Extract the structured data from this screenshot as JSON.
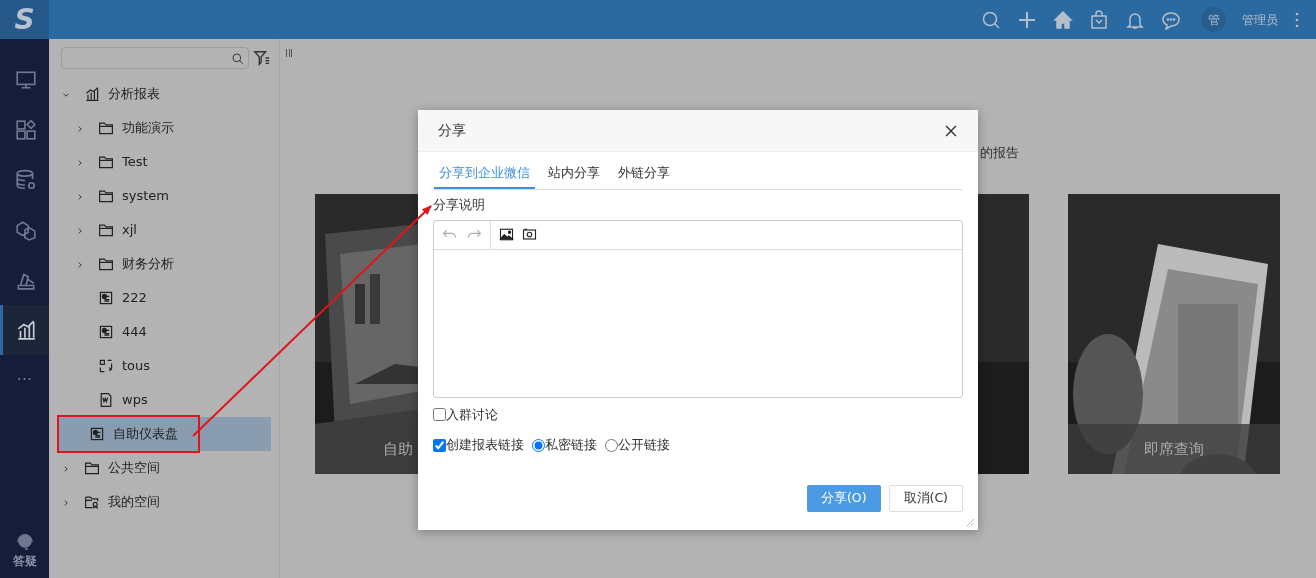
{
  "topbar": {
    "logo": "S",
    "avatar": "管",
    "user": "管理员"
  },
  "rail": {
    "items": [
      {
        "selected": false
      },
      {
        "selected": false
      },
      {
        "selected": false
      },
      {
        "selected": false
      },
      {
        "selected": false
      },
      {
        "selected": true
      }
    ],
    "more": "···",
    "help": "答疑"
  },
  "tree": {
    "nodes": [
      {
        "label": "分析报表",
        "kind": "chart",
        "expanded": true,
        "selected": false,
        "children": [
          {
            "label": "功能演示",
            "kind": "folder",
            "expanded": false,
            "selected": false
          },
          {
            "label": "Test",
            "kind": "folder",
            "expanded": false,
            "selected": false
          },
          {
            "label": "system",
            "kind": "folder",
            "expanded": false,
            "selected": false
          },
          {
            "label": "xjl",
            "kind": "folder",
            "expanded": false,
            "selected": false
          },
          {
            "label": "财务分析",
            "kind": "folder",
            "expanded": false,
            "selected": false
          },
          {
            "label": "222",
            "kind": "dashboard",
            "selected": false
          },
          {
            "label": "444",
            "kind": "dashboard",
            "selected": false
          },
          {
            "label": "tous",
            "kind": "frame",
            "selected": false
          },
          {
            "label": "wps",
            "kind": "word",
            "selected": false
          },
          {
            "label": "自助仪表盘",
            "kind": "dashboard",
            "selected": true,
            "highlighted": true
          }
        ]
      },
      {
        "label": "公共空间",
        "kind": "folder",
        "expanded": false,
        "selected": false
      },
      {
        "label": "我的空间",
        "kind": "userfolder",
        "expanded": false,
        "selected": false
      }
    ]
  },
  "main": {
    "heading": "的报告",
    "cards": [
      {
        "label": "自助",
        "kind": "picture"
      },
      {
        "kind": "picture"
      },
      {
        "label": "即席查询",
        "kind": "picture"
      }
    ]
  },
  "dialog": {
    "title": "分享",
    "tabs": [
      {
        "label": "分享到企业微信",
        "selected": true
      },
      {
        "label": "站内分享",
        "selected": false
      },
      {
        "label": "外链分享",
        "selected": false
      }
    ],
    "description_label": "分享说明",
    "join_group": {
      "label": "入群讨论",
      "checked": false
    },
    "link_options": [
      {
        "kind": "checkbox",
        "label": "创建报表链接",
        "checked": true
      },
      {
        "kind": "radio",
        "label": "私密链接",
        "checked": true
      },
      {
        "kind": "radio",
        "label": "公开链接",
        "checked": false
      }
    ],
    "buttons": [
      {
        "label": "分享(O)",
        "kind": "primary"
      },
      {
        "label": "取消(C)",
        "kind": "secondary"
      }
    ]
  }
}
